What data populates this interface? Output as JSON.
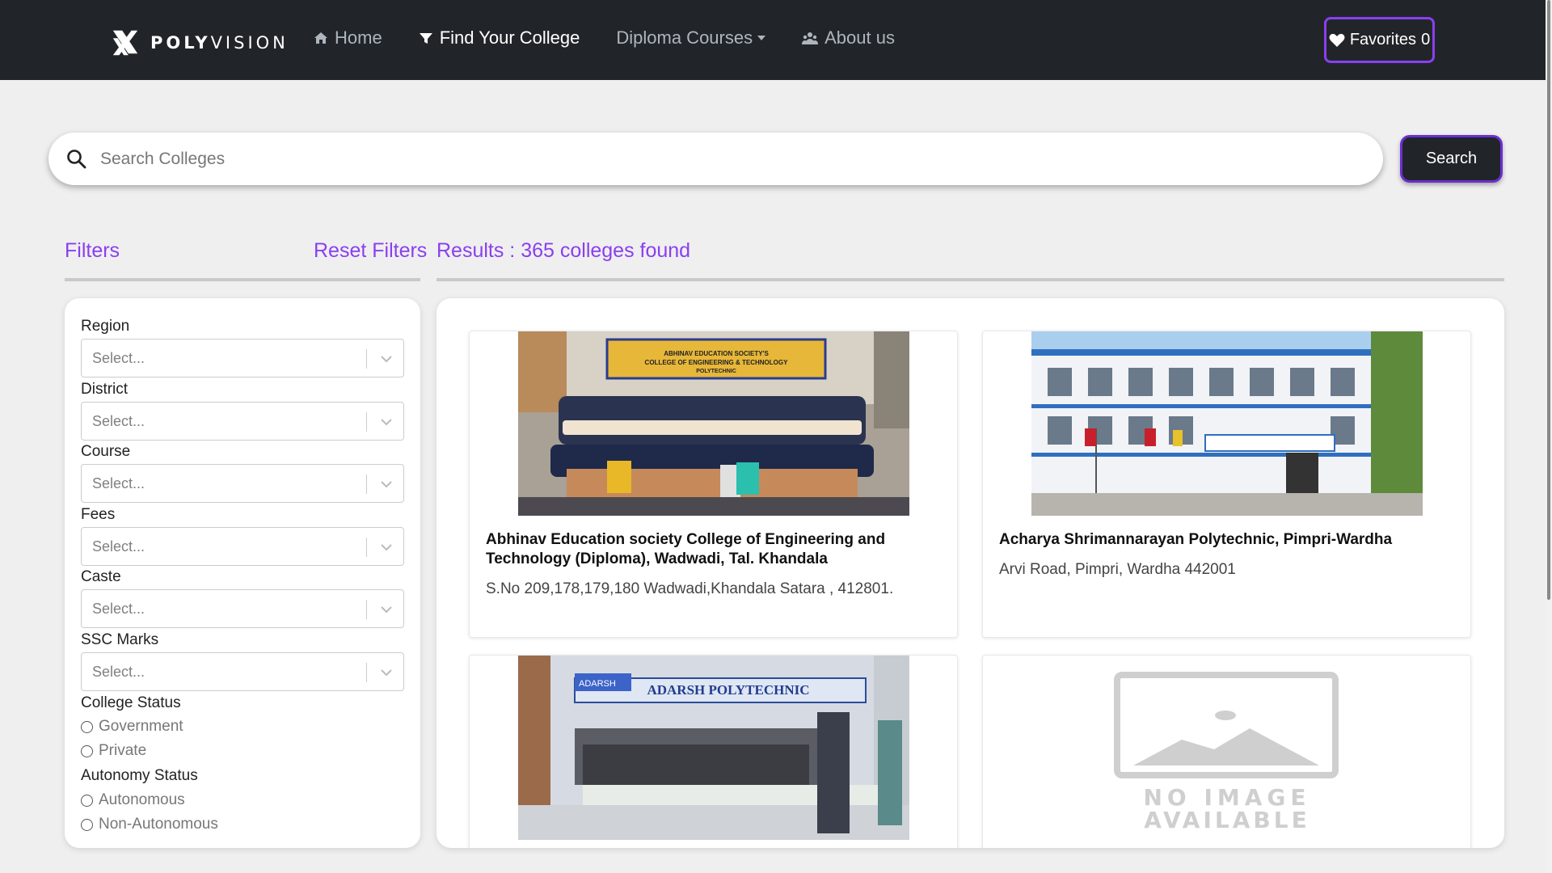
{
  "navbar": {
    "brand_bold": "POLY",
    "brand_light": "VISION",
    "links": [
      {
        "label": "Home",
        "icon": "home-icon"
      },
      {
        "label": "Find Your College",
        "icon": "filter-icon"
      },
      {
        "label": "Diploma Courses",
        "icon": "caret-down-icon"
      },
      {
        "label": "About us",
        "icon": "people-icon"
      }
    ],
    "favorites_label": "Favorites",
    "favorites_count": "0"
  },
  "search": {
    "placeholder": "Search Colleges",
    "button_label": "Search"
  },
  "filters": {
    "title": "Filters",
    "reset_label": "Reset Filters",
    "results_text": "Results : 365 colleges found",
    "dropdowns": [
      {
        "label": "Region",
        "placeholder": "Select..."
      },
      {
        "label": "District",
        "placeholder": "Select..."
      },
      {
        "label": "Course",
        "placeholder": "Select..."
      },
      {
        "label": "Fees",
        "placeholder": "Select..."
      },
      {
        "label": "Caste",
        "placeholder": "Select..."
      },
      {
        "label": "SSC Marks",
        "placeholder": "Select..."
      }
    ],
    "college_status": {
      "label": "College Status",
      "options": [
        "Government",
        "Private"
      ]
    },
    "autonomy_status": {
      "label": "Autonomy Status",
      "options": [
        "Autonomous",
        "Non-Autonomous"
      ]
    }
  },
  "colleges": [
    {
      "name": "Abhinav Education society College of Engineering and Technology (Diploma), Wadwadi, Tal. Khandala",
      "address": "S.No 209,178,179,180 Wadwadi,Khandala Satara , 412801.",
      "image_banner": "ABHINAV EDUCATION SOCIETY'S COLLEGE OF ENGINEERING & TECHNOLOGY POLYTECHNIC"
    },
    {
      "name": "Acharya Shrimannarayan Polytechnic, Pimpri-Wardha",
      "address": "Arvi Road, Pimpri, Wardha 442001",
      "image_banner": ""
    },
    {
      "name": "",
      "address": "",
      "image_banner": "ADARSH POLYTECHNIC"
    },
    {
      "name": "",
      "address": "",
      "image_banner": "NO IMAGE AVAILABLE"
    }
  ],
  "colors": {
    "accent": "#8a3ff0",
    "navbar_bg": "#212529",
    "page_bg": "#efefef"
  }
}
